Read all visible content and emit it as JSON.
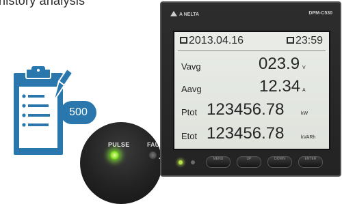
{
  "caption": "nistory analysis",
  "badge": "500",
  "zoom": {
    "pulse_label": "PULSE",
    "fault_label": "FAU"
  },
  "meter": {
    "brand": "A NELTA",
    "model": "DPM-C530",
    "date": "2013.04.16",
    "time": "23:59",
    "readings": [
      {
        "label": "Vavg",
        "value": "023.9",
        "unit": "V"
      },
      {
        "label": "Aavg",
        "value": "12.34",
        "unit": "A"
      },
      {
        "label": "Ptot",
        "value": "123456.78",
        "unit": "kW"
      },
      {
        "label": "Etot",
        "value": "123456.78",
        "unit": "kVARh"
      }
    ],
    "buttons": [
      "MENU",
      "UP",
      "DOWN",
      "ENTER"
    ]
  },
  "colors": {
    "badge": "#2a77ad",
    "pulse_led": "#8ee030",
    "icon": "#2a77ad"
  }
}
